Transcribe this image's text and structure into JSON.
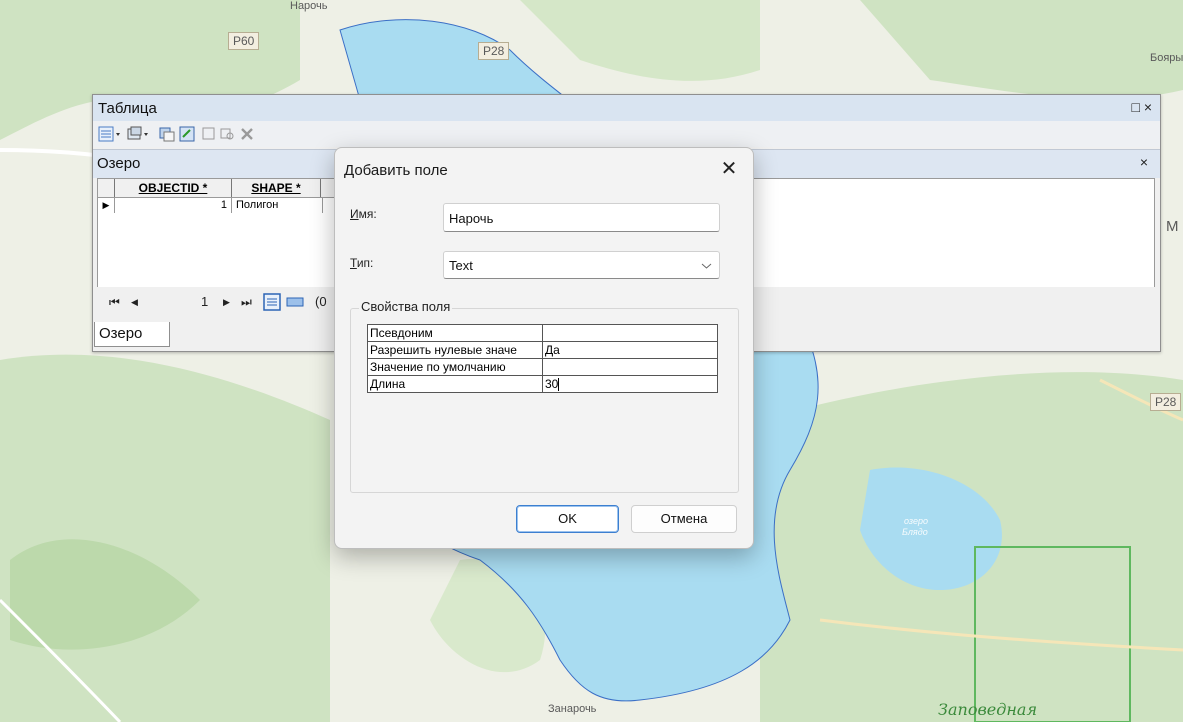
{
  "map": {
    "road_labels": [
      "P60",
      "P28",
      "P28"
    ],
    "place_labels": [
      "Нарочь",
      "Бояры",
      "Занарочь",
      "М"
    ],
    "green_label": "Заповедная",
    "water_label_line1": "озеро",
    "water_label_line2": "Блядо",
    "colors": {
      "water": "#a9dcf1",
      "water_edge": "#3b6fc6",
      "forest": "#cfe3c2",
      "land": "#eef0e6",
      "reserve_border": "#5fb85f"
    }
  },
  "table_window": {
    "title": "Таблица",
    "title_controls": "□ ×",
    "tab_header": "Озеро",
    "tab_close": "×",
    "columns": [
      "OBJECTID *",
      "SHAPE *"
    ],
    "rows": [
      {
        "objectid": "1",
        "shape": "Полигон"
      }
    ],
    "nav": {
      "first": "⏮",
      "prev": "◀",
      "current": "1",
      "next": "▶",
      "last": "⏭",
      "count_prefix": "(0"
    },
    "bottom_tab": "Озеро"
  },
  "dialog": {
    "title": "Добавить поле",
    "close": "✕",
    "name_label_u": "И",
    "name_label_rest": "мя:",
    "name_value": "Нарочь",
    "type_label_u": "Т",
    "type_label_rest": "ип:",
    "type_value": "Text",
    "props_title": "Свойства поля",
    "props": [
      {
        "key": "Псевдоним",
        "value": ""
      },
      {
        "key": "Разрешить нулевые значе",
        "value": "Да"
      },
      {
        "key": "Значение по умолчанию",
        "value": ""
      },
      {
        "key": "Длина",
        "value": "30"
      }
    ],
    "ok_label": "OK",
    "cancel_label": "Отмена"
  }
}
